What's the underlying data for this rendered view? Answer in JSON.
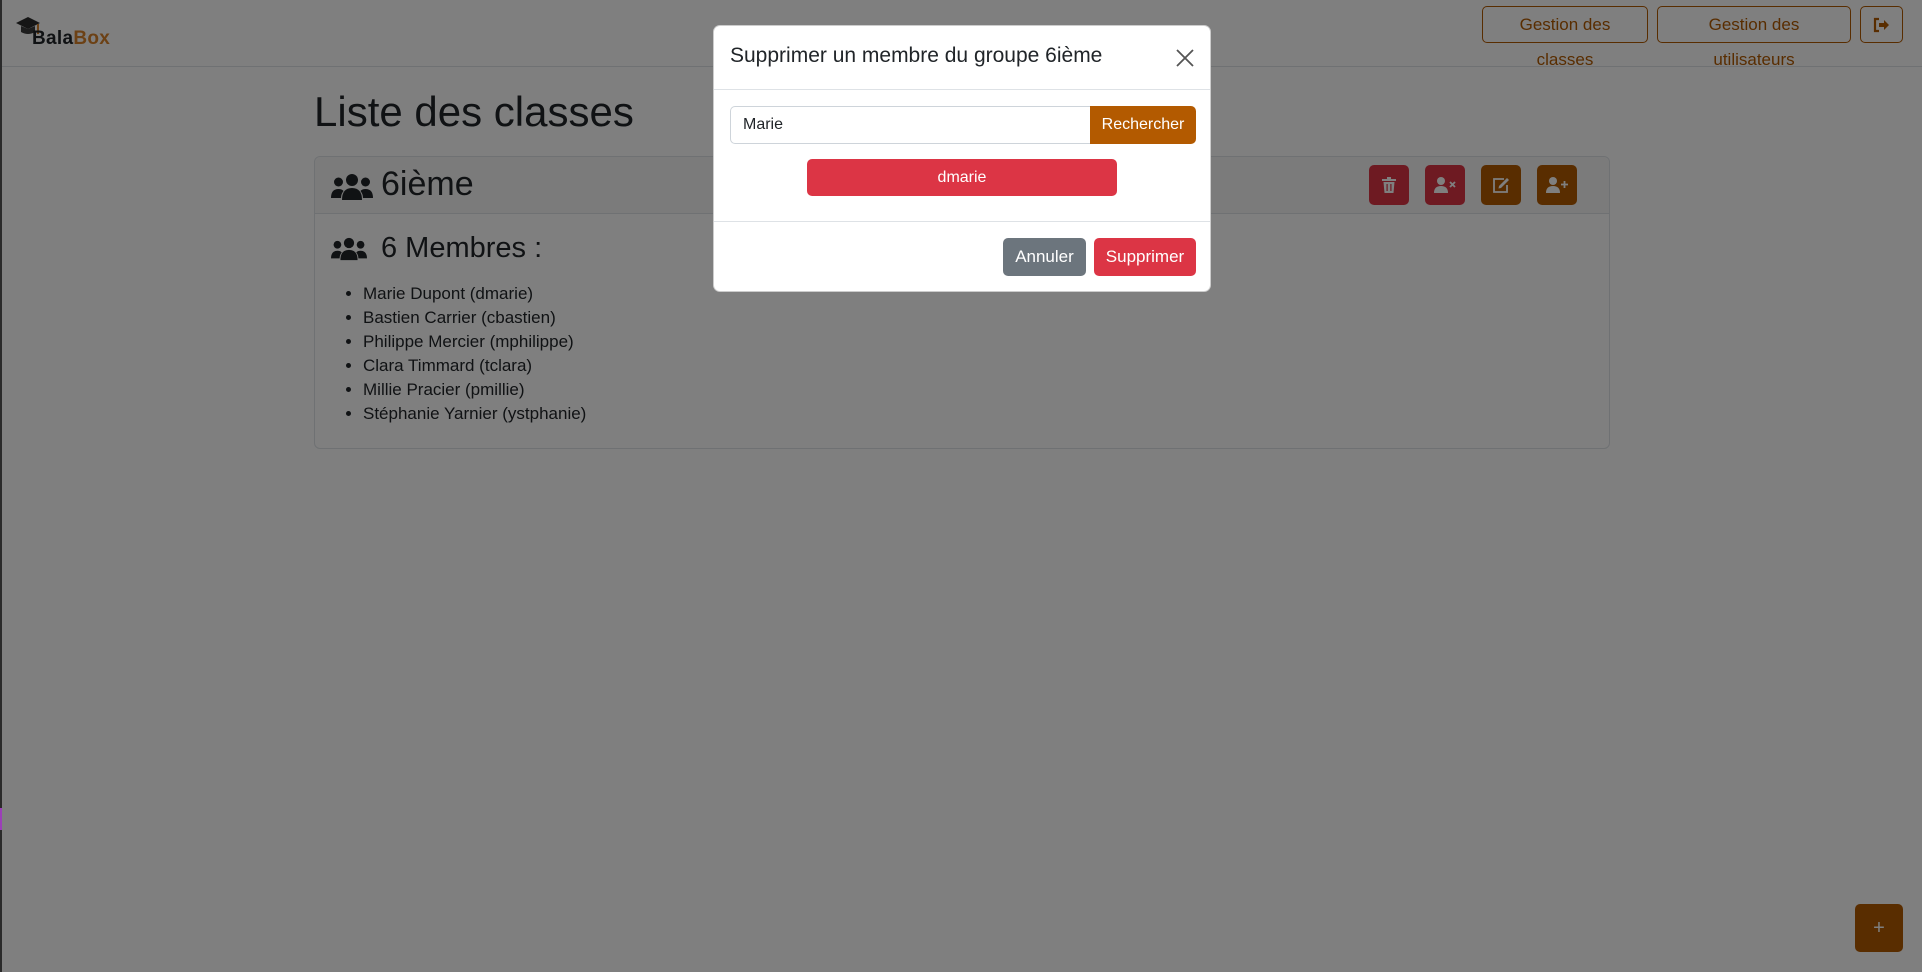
{
  "navbar": {
    "brand": {
      "part1": "Bala",
      "part2": "Box"
    },
    "classes_btn": "Gestion des classes",
    "users_btn": "Gestion des utilisateurs",
    "logout_icon": "sign-out-icon"
  },
  "main": {
    "title": "Liste des classes",
    "card": {
      "class_name": "6ième",
      "members_label": "6 Membres :",
      "members": [
        "Marie Dupont (dmarie)",
        "Bastien Carrier (cbastien)",
        "Philippe Mercier (mphilippe)",
        "Clara Timmard (tclara)",
        "Millie Pracier (pmillie)",
        "Stéphanie Yarnier (ystphanie)"
      ],
      "actions": [
        "trash-icon",
        "user-remove-icon",
        "edit-icon",
        "user-add-icon"
      ]
    },
    "fab_label": "+"
  },
  "modal": {
    "title": "Supprimer un membre du groupe 6ième",
    "search_value": "Marie",
    "search_btn": "Rechercher",
    "result": "dmarie",
    "cancel_btn": "Annuler",
    "delete_btn": "Supprimer"
  },
  "colors": {
    "brand": "#b35a00",
    "danger": "#dc3545",
    "secondary": "#6c757d"
  }
}
